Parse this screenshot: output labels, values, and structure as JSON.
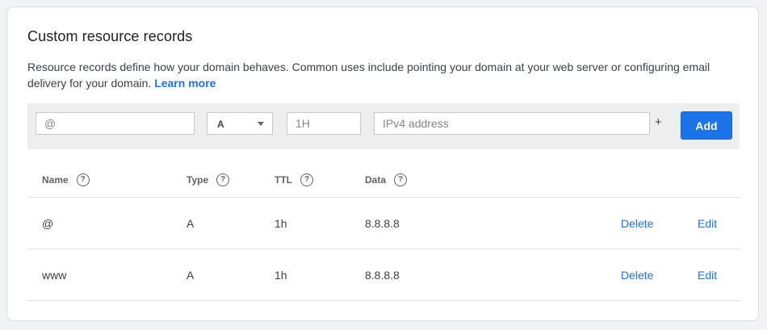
{
  "card": {
    "title": "Custom resource records",
    "description": "Resource records define how your domain behaves. Common uses include pointing your domain at your web server or configuring email delivery for your domain.",
    "learn_more": "Learn more"
  },
  "form": {
    "name_placeholder": "@",
    "type_value": "A",
    "ttl_placeholder": "1H",
    "data_placeholder": "IPv4 address",
    "plus_label": "+",
    "add_label": "Add"
  },
  "table": {
    "headers": {
      "name": "Name",
      "type": "Type",
      "ttl": "TTL",
      "data": "Data"
    },
    "help_glyph": "?",
    "rows": [
      {
        "name": "@",
        "type": "A",
        "ttl": "1h",
        "data": "8.8.8.8",
        "delete": "Delete",
        "edit": "Edit"
      },
      {
        "name": "www",
        "type": "A",
        "ttl": "1h",
        "data": "8.8.8.8",
        "delete": "Delete",
        "edit": "Edit"
      }
    ]
  },
  "colors": {
    "accent": "#1a73e8",
    "form_bar": "#eeeeee",
    "text": "#3c4043"
  },
  "icons": [
    "help-icon",
    "dropdown-caret-icon",
    "plus-icon"
  ]
}
